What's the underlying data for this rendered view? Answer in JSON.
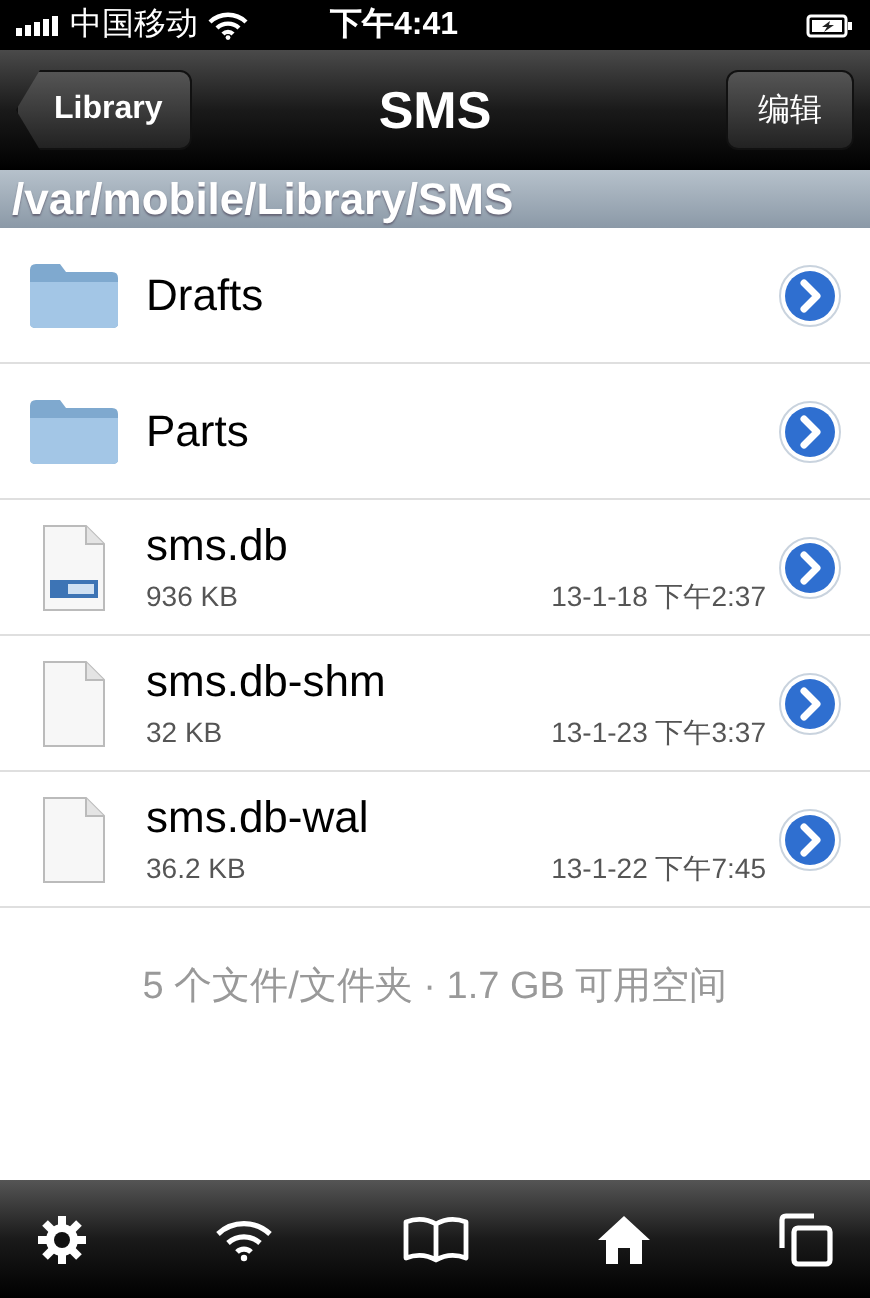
{
  "status_bar": {
    "carrier": "中国移动",
    "time": "下午4:41"
  },
  "nav_bar": {
    "back": "Library",
    "title": "SMS",
    "edit": "编辑"
  },
  "path": "/var/mobile/Library/SMS",
  "items": [
    {
      "kind": "folder",
      "name": "Drafts"
    },
    {
      "kind": "folder",
      "name": "Parts"
    },
    {
      "kind": "database",
      "name": "sms.db",
      "size": "936 KB",
      "date": "13-1-18 下午2:37"
    },
    {
      "kind": "file",
      "name": "sms.db-shm",
      "size": "32 KB",
      "date": "13-1-23 下午3:37"
    },
    {
      "kind": "file",
      "name": "sms.db-wal",
      "size": "36.2 KB",
      "date": "13-1-22 下午7:45"
    }
  ],
  "footer": "5 个文件/文件夹 · 1.7 GB 可用空间"
}
